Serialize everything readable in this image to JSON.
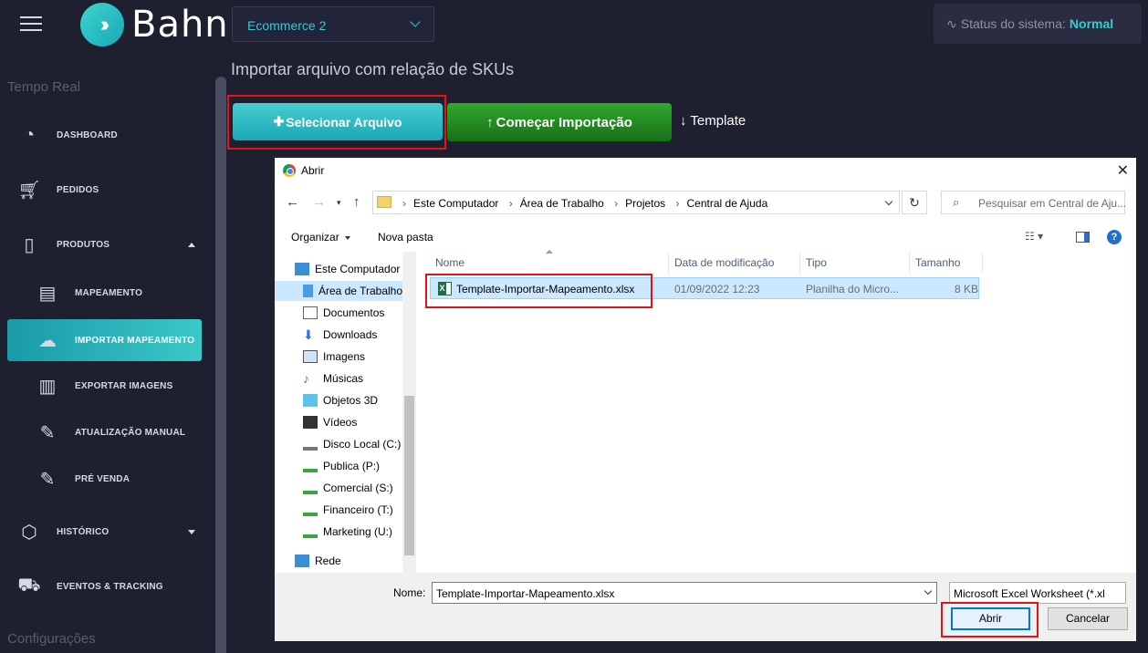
{
  "app": {
    "logo_text": "Bahn",
    "store_select": "Ecommerce 2",
    "status_label": "Status do sistema:",
    "status_value": "Normal",
    "page_title": "Importar arquivo com relação de SKUs"
  },
  "sidebar": {
    "section_realtime": "Tempo Real",
    "section_config": "Configurações",
    "items": [
      {
        "label": "DASHBOARD"
      },
      {
        "label": "PEDIDOS"
      },
      {
        "label": "PRODUTOS"
      },
      {
        "label": "MAPEAMENTO"
      },
      {
        "label": "IMPORTAR MAPEAMENTO"
      },
      {
        "label": "EXPORTAR IMAGENS"
      },
      {
        "label": "ATUALIZAÇÃO MANUAL"
      },
      {
        "label": "PRÉ VENDA"
      },
      {
        "label": "HISTÓRICO"
      },
      {
        "label": "EVENTOS & TRACKING"
      }
    ]
  },
  "actions": {
    "select_file": "Selecionar Arquivo",
    "start_import": "Começar Importação",
    "template": "Template"
  },
  "dialog": {
    "title": "Abrir",
    "breadcrumbs": [
      "Este Computador",
      "Área de Trabalho",
      "Projetos",
      "Central de Ajuda"
    ],
    "search_placeholder": "Pesquisar em Central de Aju...",
    "organize": "Organizar",
    "new_folder": "Nova pasta",
    "tree": [
      "Este Computador",
      "Área de Trabalho",
      "Documentos",
      "Downloads",
      "Imagens",
      "Músicas",
      "Objetos 3D",
      "Vídeos",
      "Disco Local (C:)",
      "Publica (P:)",
      "Comercial (S:)",
      "Financeiro (T:)",
      "Marketing (U:)",
      "Rede"
    ],
    "columns": {
      "name": "Nome",
      "date": "Data de modificação",
      "type": "Tipo",
      "size": "Tamanho"
    },
    "file": {
      "name": "Template-Importar-Mapeamento.xlsx",
      "date": "01/09/2022 12:23",
      "type": "Planilha do Micro...",
      "size": "8 KB"
    },
    "name_label": "Nome:",
    "name_value": "Template-Importar-Mapeamento.xlsx",
    "filetype_value": "Microsoft Excel Worksheet (*.xl",
    "open_button": "Abrir",
    "cancel_button": "Cancelar"
  }
}
